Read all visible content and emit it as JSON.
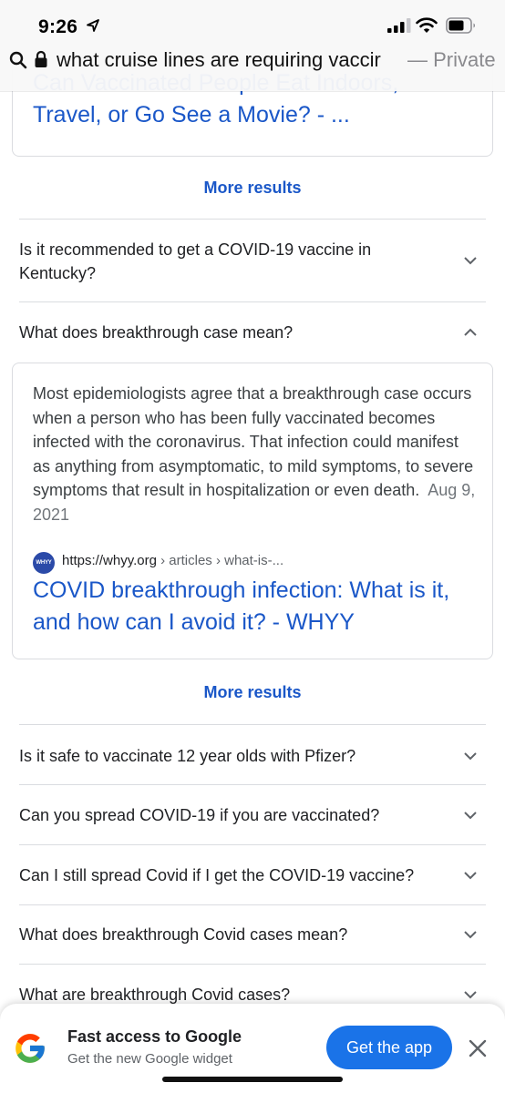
{
  "status_bar": {
    "time": "9:26"
  },
  "url_bar": {
    "query": "what cruise lines are requiring vaccir",
    "mode_label": "— Private"
  },
  "previous_result": {
    "title_line1": "Can Vaccinated People Eat Indoors,",
    "title_line2": "Travel, or Go See a Movie? - ..."
  },
  "more_results_label": "More results",
  "faq": [
    {
      "question": "Is it recommended to get a COVID-19 vaccine in Kentucky?",
      "expanded": false
    },
    {
      "question": "What does breakthrough case mean?",
      "expanded": true
    },
    {
      "question": "Is it safe to vaccinate 12 year olds with Pfizer?",
      "expanded": false
    },
    {
      "question": "Can you spread COVID-19 if you are vaccinated?",
      "expanded": false
    },
    {
      "question": "Can I still spread Covid if I get the COVID-19 vaccine?",
      "expanded": false
    },
    {
      "question": "What does breakthrough Covid cases mean?",
      "expanded": false
    },
    {
      "question": "What are breakthrough Covid cases?",
      "expanded": false
    }
  ],
  "answer": {
    "text": "Most epidemiologists agree that a breakthrough case occurs when a person who has been fully vaccinated becomes infected with the coronavirus. That infection could manifest as anything from asymptomatic, to mild symptoms, to severe symptoms that result in hospitalization or even death.",
    "date": "Aug 9, 2021",
    "source_logo": "WHYY",
    "source_domain": "https://whyy.org",
    "source_path": " › articles › what-is-...",
    "source_title": "COVID breakthrough infection: What is it, and how can I avoid it? - WHYY"
  },
  "banner": {
    "title": "Fast access to Google",
    "subtitle": "Get the new Google widget",
    "button": "Get the app"
  },
  "colors": {
    "link": "#1a57c8",
    "button": "#1a73e8",
    "divider": "#dadce0"
  }
}
